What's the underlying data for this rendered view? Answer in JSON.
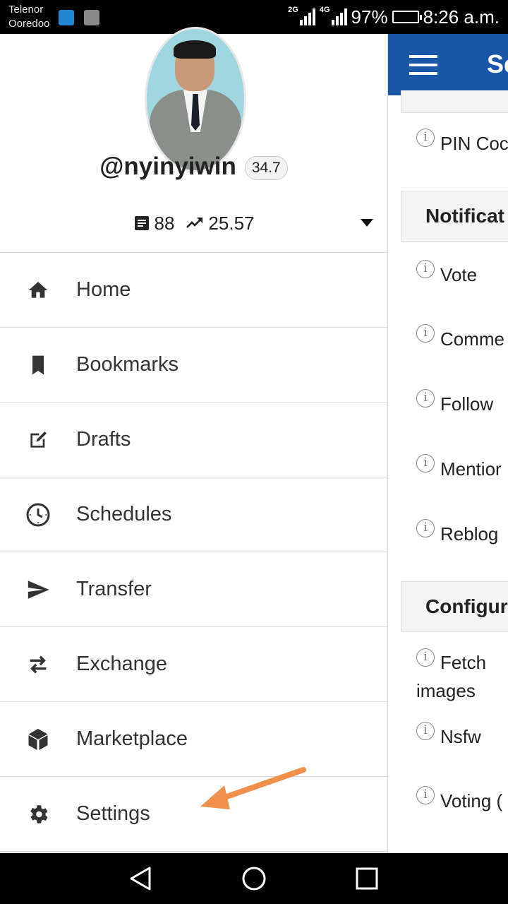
{
  "status_bar": {
    "carrier_1": "Telenor",
    "carrier_2": "Ooredoo",
    "network_1": "2G",
    "network_2": "4G",
    "battery": "97%",
    "battery_level": 0.97,
    "time": "8:26 a.m."
  },
  "profile": {
    "username": "@nyinyiwin",
    "reputation": "34.7",
    "post_count": "88",
    "voting_power": "25.57"
  },
  "menu": {
    "items": [
      {
        "label": "Home",
        "icon": "home-icon"
      },
      {
        "label": "Bookmarks",
        "icon": "bookmark-icon"
      },
      {
        "label": "Drafts",
        "icon": "edit-icon"
      },
      {
        "label": "Schedules",
        "icon": "clock-icon"
      },
      {
        "label": "Transfer",
        "icon": "send-icon"
      },
      {
        "label": "Exchange",
        "icon": "swap-icon"
      },
      {
        "label": "Marketplace",
        "icon": "cube-icon"
      },
      {
        "label": "Settings",
        "icon": "gear-icon"
      }
    ]
  },
  "annotation": {
    "arrow_color": "#f0904a"
  },
  "settings_panel": {
    "title": "Se",
    "pin_code": "PIN Coc",
    "notifications_header": "Notificat",
    "notifications": [
      "Vote",
      "Comme",
      "Follow",
      "Mentior",
      "Reblog"
    ],
    "configuration_header": "Configur",
    "fetch_images": "Fetch images",
    "nsfw": "Nsfw",
    "voting": "Voting (",
    "accent_color": "#1a56a8"
  }
}
